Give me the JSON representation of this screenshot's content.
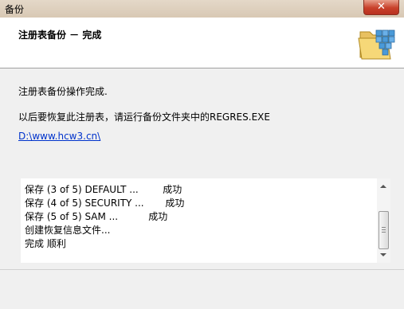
{
  "window": {
    "title": "备份",
    "close_label": "✕"
  },
  "header": {
    "title": "注册表备份 － 完成",
    "icon": "registry-folder-icon"
  },
  "content": {
    "message1": "注册表备份操作完成.",
    "message2": "以后要恢复此注册表，请运行备份文件夹中的REGRES.EXE",
    "path_link": "D:\\www.hcw3.cn\\"
  },
  "log": {
    "lines": [
      "保存 (3 of 5) DEFAULT ...        成功",
      "保存 (4 of 5) SECURITY ...       成功",
      "保存 (5 of 5) SAM ...          成功",
      "创建恢复信息文件...",
      "完成 顺利"
    ]
  }
}
